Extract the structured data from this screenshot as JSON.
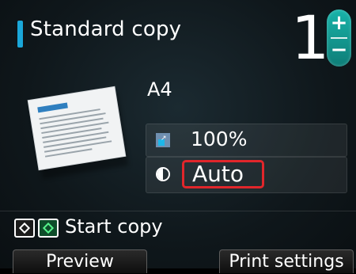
{
  "header": {
    "title": "Standard copy",
    "copies": "1",
    "stepper": {
      "increment_icon": "plus-icon",
      "decrement_icon": "minus-icon"
    }
  },
  "settings": {
    "paper_size": "A4",
    "magnification": "100%",
    "density": "Auto"
  },
  "footer": {
    "start_label": "Start copy",
    "keys": [
      {
        "name": "black-start-key-icon"
      },
      {
        "name": "color-start-key-icon"
      }
    ],
    "softkeys": [
      {
        "label": "Preview"
      },
      {
        "label": "Print settings"
      }
    ]
  },
  "colors": {
    "accent": "#1aa7d9",
    "stepper": "#18b3a9",
    "highlight": "#e1262b",
    "color_key": "#56f28b"
  }
}
